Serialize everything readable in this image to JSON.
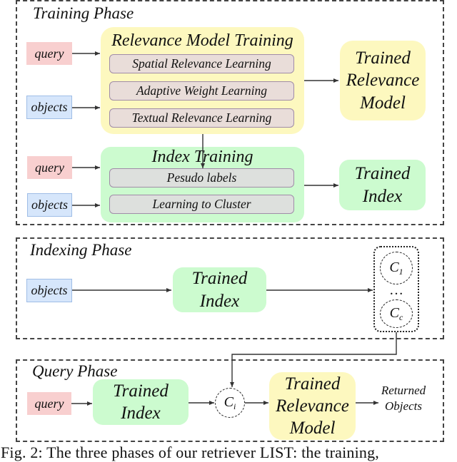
{
  "training_phase": {
    "title": "Training Phase",
    "relevance_training": {
      "inputs": [
        "query",
        "objects"
      ],
      "title": "Relevance Model Training",
      "steps": [
        "Spatial Relevance Learning",
        "Adaptive Weight Learning",
        "Textual Relevance Learning"
      ],
      "output": [
        "Trained",
        "Relevance",
        "Model"
      ]
    },
    "index_training": {
      "inputs": [
        "query",
        "objects"
      ],
      "title": "Index Training",
      "steps": [
        "Pesudo labels",
        "Learning to Cluster"
      ],
      "output": [
        "Trained",
        "Index"
      ]
    }
  },
  "indexing_phase": {
    "title": "Indexing Phase",
    "input": "objects",
    "model": [
      "Trained",
      "Index"
    ],
    "clusters": {
      "first": {
        "base": "C",
        "sub": "1"
      },
      "ellipsis": "…",
      "last": {
        "base": "C",
        "sub": "c"
      }
    }
  },
  "query_phase": {
    "title": "Query Phase",
    "input": "query",
    "index": [
      "Trained",
      "Index"
    ],
    "cluster": {
      "base": "C",
      "sub": "i"
    },
    "model": [
      "Trained",
      "Relevance",
      "Model"
    ],
    "output": [
      "Returned",
      "Objects"
    ]
  },
  "colors": {
    "query": "#f8cfcf",
    "objects": "#d6e6fb",
    "relevance_model": "#fdf8bf",
    "index": "#ccfbcf",
    "step_relevance": "#e9ddd9",
    "step_index": "#dde0dd"
  },
  "caption": "Fig. 2: The three phases of our retriever LIST: the training,"
}
